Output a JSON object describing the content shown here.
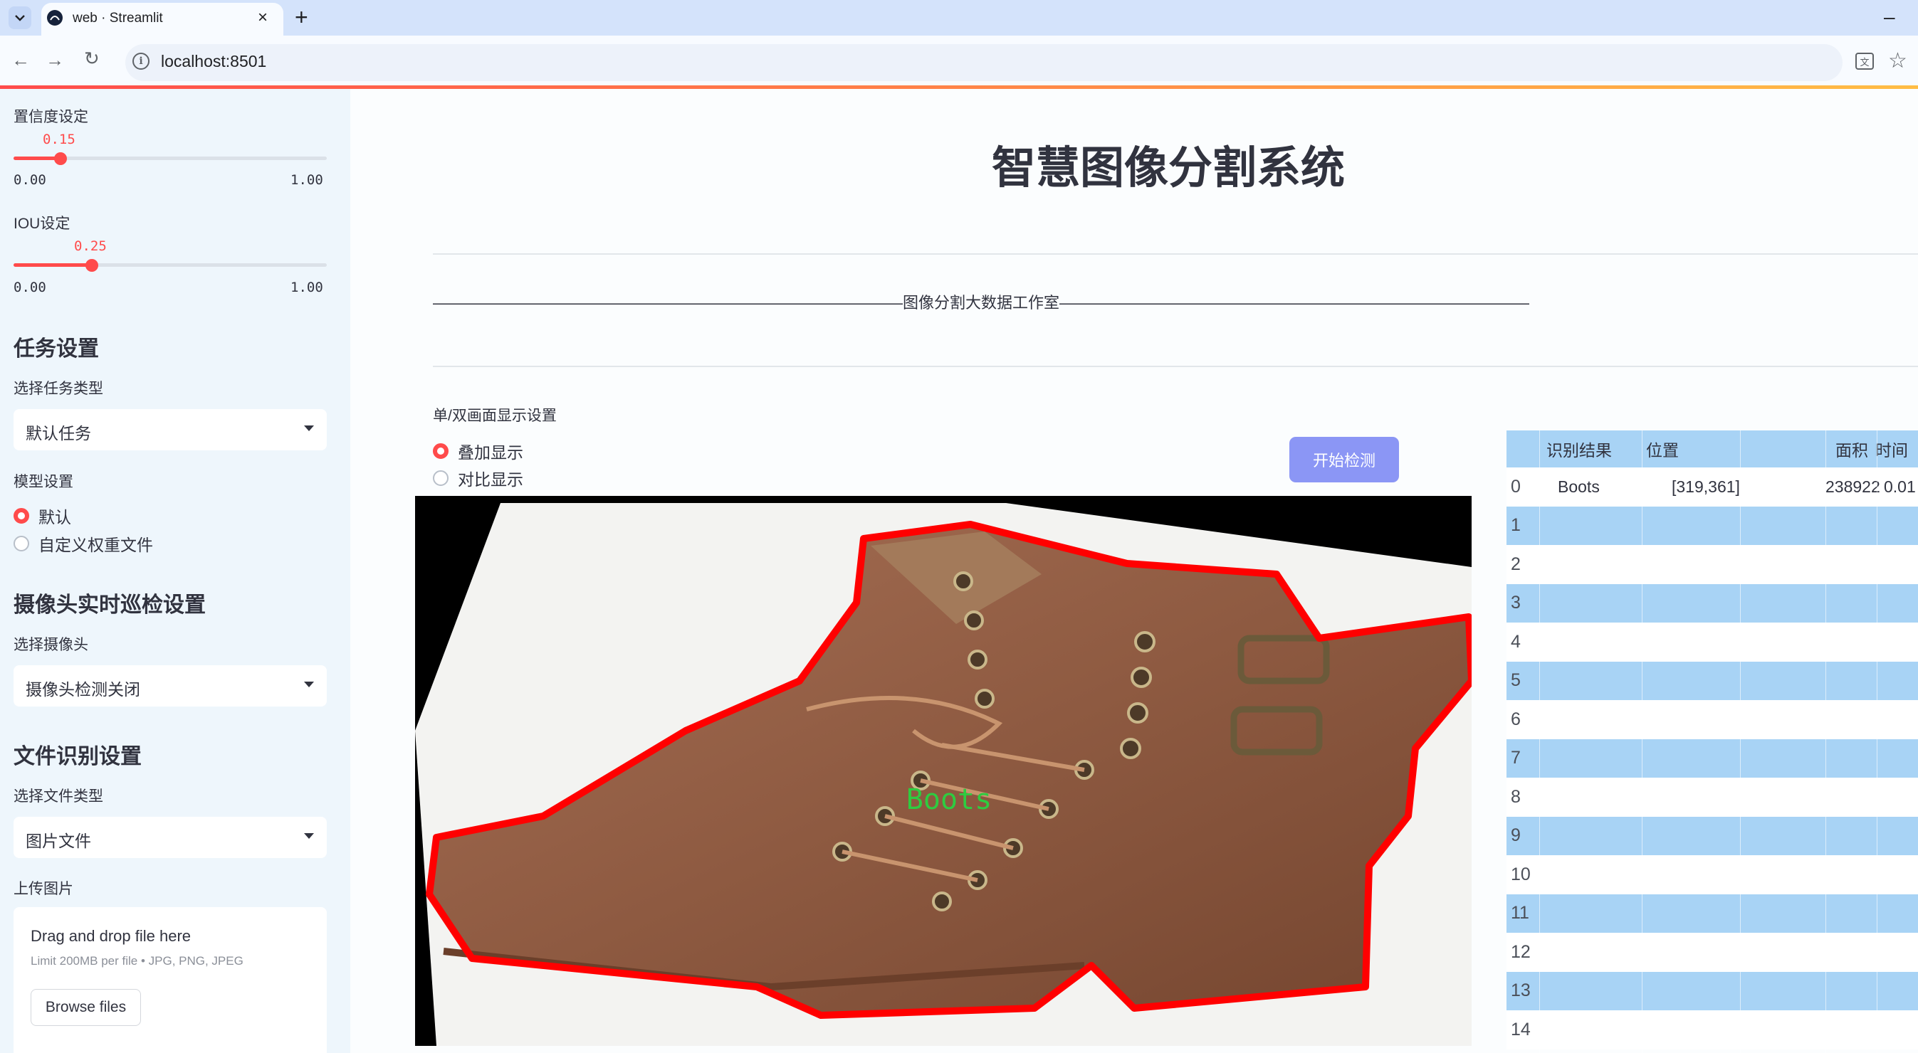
{
  "browser": {
    "tab_title": "web · Streamlit",
    "url": "localhost:8501"
  },
  "sidebar": {
    "confidence": {
      "label": "置信度设定",
      "value": "0.15",
      "value_fraction": 0.15,
      "min": "0.00",
      "max": "1.00"
    },
    "iou": {
      "label": "IOU设定",
      "value": "0.25",
      "value_fraction": 0.25,
      "min": "0.00",
      "max": "1.00"
    },
    "task_header": "任务设置",
    "task_type_label": "选择任务类型",
    "task_type_value": "默认任务",
    "model_label": "模型设置",
    "model_options": [
      "默认",
      "自定义权重文件"
    ],
    "model_selected": "默认",
    "camera_header": "摄像头实时巡检设置",
    "camera_label": "选择摄像头",
    "camera_value": "摄像头检测关闭",
    "file_header": "文件识别设置",
    "file_type_label": "选择文件类型",
    "file_type_value": "图片文件",
    "upload_label": "上传图片",
    "upload": {
      "title": "Drag and drop file here",
      "limit": "Limit 200MB per file • JPG, PNG, JPEG",
      "button": "Browse files"
    }
  },
  "main": {
    "title": "智慧图像分割系统",
    "studio_line": "——————————————————————————————图像分割大数据工作室——————————————————————————————",
    "display_mode_label": "单/双画面显示设置",
    "display_options": [
      "叠加显示",
      "对比显示"
    ],
    "display_selected": "叠加显示",
    "start_button": "开始检测",
    "detection_label": "Boots"
  },
  "table": {
    "headers": [
      "识别结果",
      "位置",
      "面积",
      "时间"
    ],
    "rows": [
      {
        "index": "0",
        "result": "Boots",
        "position": "[319,361]",
        "area": "238922",
        "time": "0.01"
      },
      {
        "index": "1"
      },
      {
        "index": "2"
      },
      {
        "index": "3"
      },
      {
        "index": "4"
      },
      {
        "index": "5"
      },
      {
        "index": "6"
      },
      {
        "index": "7"
      },
      {
        "index": "8"
      },
      {
        "index": "9"
      },
      {
        "index": "10"
      },
      {
        "index": "11"
      },
      {
        "index": "12"
      },
      {
        "index": "13"
      },
      {
        "index": "14"
      }
    ]
  },
  "colors": {
    "accent": "#ff4b4b",
    "sidebar_bg": "#eef6fc",
    "button_bg": "#8b96f5",
    "table_header": "#a8d3f5",
    "table_row_alt": "#a8d3f5",
    "mask_outline": "#ff0000",
    "label_text": "#2ecc40"
  }
}
